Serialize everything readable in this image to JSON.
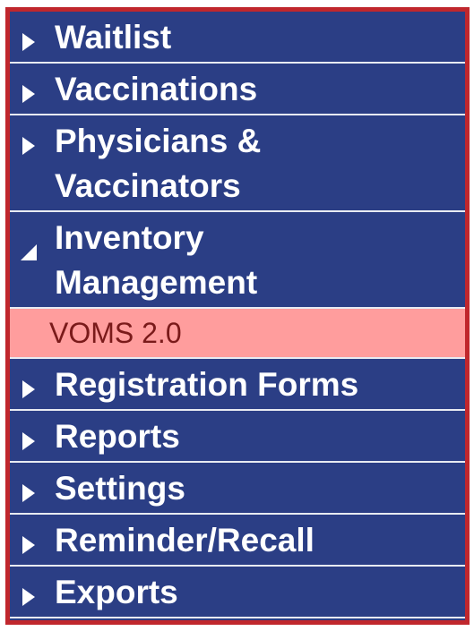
{
  "menu": {
    "items": [
      {
        "label": "Waitlist",
        "icon": "triangle-right-icon"
      },
      {
        "label": "Vaccinations",
        "icon": "triangle-right-icon"
      },
      {
        "label_line1": "Physicians &",
        "label_line2": "Vaccinators",
        "icon": "triangle-right-icon"
      },
      {
        "label_line1": "Inventory",
        "label_line2": "Management",
        "icon": "triangle-down-icon",
        "expanded": true,
        "subitems": [
          {
            "label": "VOMS 2.0",
            "selected": true
          }
        ]
      },
      {
        "label": "Registration Forms",
        "icon": "triangle-right-icon"
      },
      {
        "label": "Reports",
        "icon": "triangle-right-icon"
      },
      {
        "label": "Settings",
        "icon": "triangle-right-icon"
      },
      {
        "label": "Reminder/Recall",
        "icon": "triangle-right-icon"
      },
      {
        "label": "Exports",
        "icon": "triangle-right-icon"
      }
    ]
  },
  "colors": {
    "menu_bg": "#2b3e85",
    "frame_border": "#c0272d",
    "selected_bg": "#ff9d9d",
    "selected_text": "#7a1a1a",
    "text": "#ffffff"
  }
}
